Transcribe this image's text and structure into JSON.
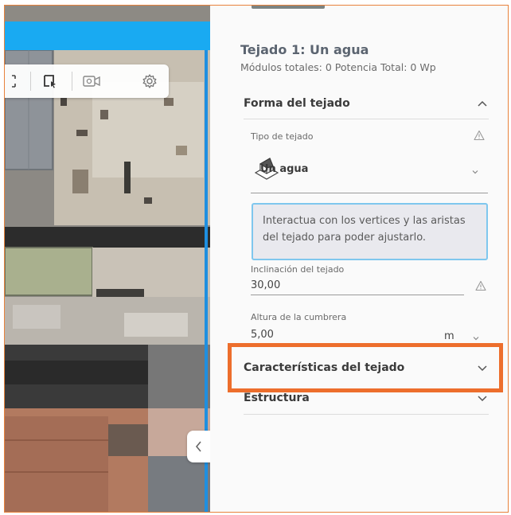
{
  "map": {
    "toolbar": {
      "tools": [
        {
          "icon": "select-corners-icon"
        },
        {
          "icon": "polygon-select-icon"
        },
        {
          "icon": "video-camera-icon"
        },
        {
          "icon": "gear-icon"
        }
      ]
    },
    "collapse_icon": "chevron-left-icon"
  },
  "panel": {
    "title": "Tejado 1: Un agua",
    "subtitle": "Módulos totales: 0 Potencia Total: 0 Wp",
    "sections": {
      "forma": {
        "label": "Forma del tejado",
        "expanded": true,
        "roof_type": {
          "label": "Tipo de tejado",
          "value": "Un agua"
        },
        "info_text": "Interactua con los vertices y las aristas del tejado para poder ajustarlo.",
        "inclination": {
          "label": "Inclinación del tejado",
          "value": "30,00"
        },
        "ridge_height": {
          "label": "Altura de la cumbrera",
          "value": "5,00",
          "unit": "m"
        }
      },
      "caracteristicas": {
        "label": "Características del tejado",
        "expanded": false
      },
      "estructura": {
        "label": "Estructura",
        "expanded": false
      }
    }
  },
  "colors": {
    "highlight": "#ed6e2c",
    "map_accent": "#19aaf2",
    "info_border": "#7fc7ee"
  }
}
